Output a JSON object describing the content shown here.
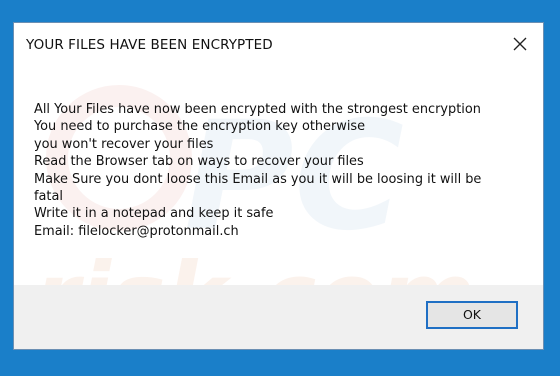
{
  "dialog": {
    "title": "YOUR FILES HAVE BEEN ENCRYPTED",
    "message_lines": [
      "All Your Files have now been encrypted with the strongest encryption",
      "You need to purchase the encryption key otherwise",
      "you won't recover your files",
      "Read the Browser tab on ways to recover your files",
      "Make Sure you dont loose this Email as you it will be loosing it will be",
      "fatal",
      "Write it in a notepad and keep it safe",
      "Email: filelocker@protonmail.ch"
    ],
    "ok_label": "OK"
  },
  "watermark": {
    "text": "risk.com",
    "logo_text": "PC"
  },
  "colors": {
    "desktop_background": "#1a7fc9",
    "dialog_background": "#ffffff",
    "footer_background": "#f0f0f0",
    "button_focus_border": "#1f6fc4"
  },
  "icons": {
    "close": "close-icon"
  }
}
